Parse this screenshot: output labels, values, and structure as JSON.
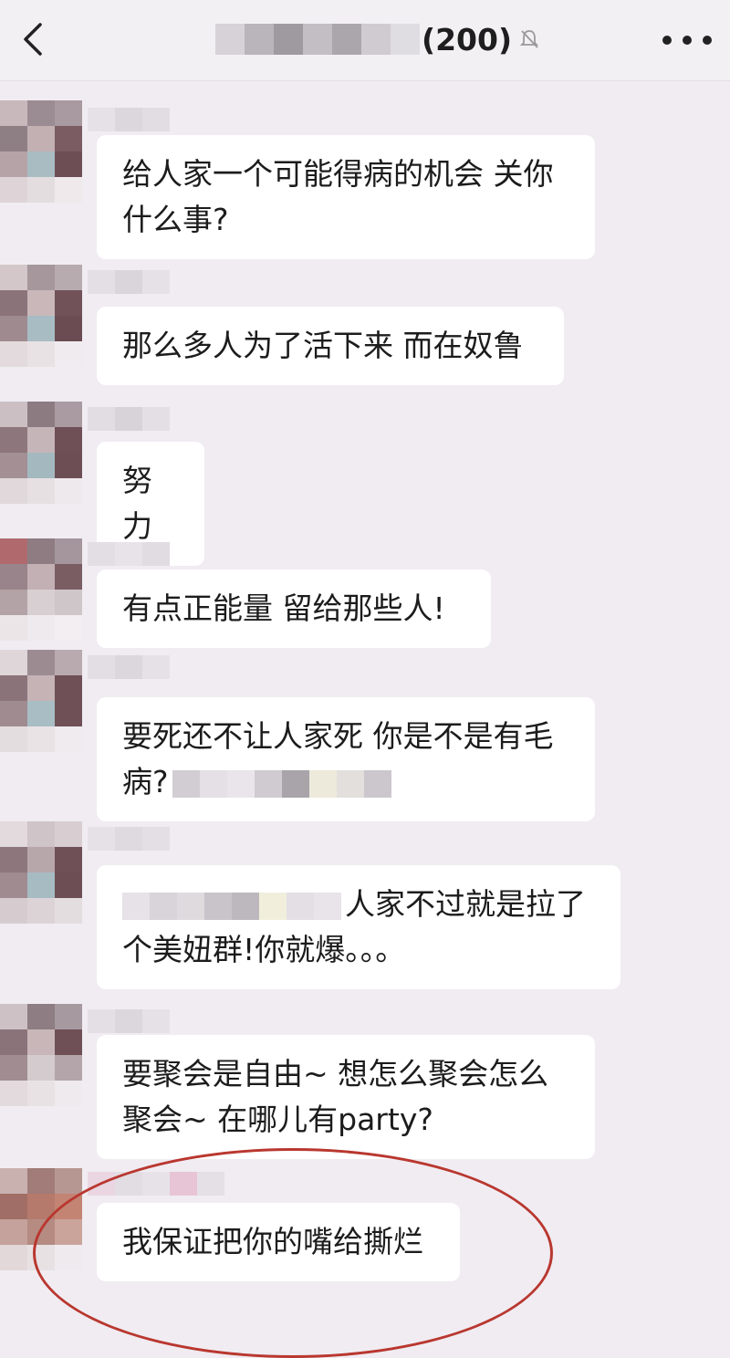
{
  "header": {
    "title_count": "(200)",
    "back_icon": "chevron-left-icon",
    "mute_icon": "bell-muted-icon",
    "more_icon": "more-dots-icon"
  },
  "messages": [
    {
      "line1": "给人家一个可能得病的机会 关你",
      "line2": "什么事?"
    },
    {
      "line1": "那么多人为了活下来 而在奴鲁"
    },
    {
      "line1": "努力"
    },
    {
      "line1": "有点正能量 留给那些人!"
    },
    {
      "line1": "要死还不让人家死 你是不是有毛",
      "line2": "病?"
    },
    {
      "line1": "人家不过就是拉了",
      "line2": "个美妞群!你就爆。。。"
    },
    {
      "line1": "要聚会是自由~ 想怎么聚会怎么",
      "line2": "聚会~ 在哪儿有party?"
    },
    {
      "line1": "我保证把你的嘴给撕烂"
    }
  ],
  "annotation_color": "#b9372f"
}
